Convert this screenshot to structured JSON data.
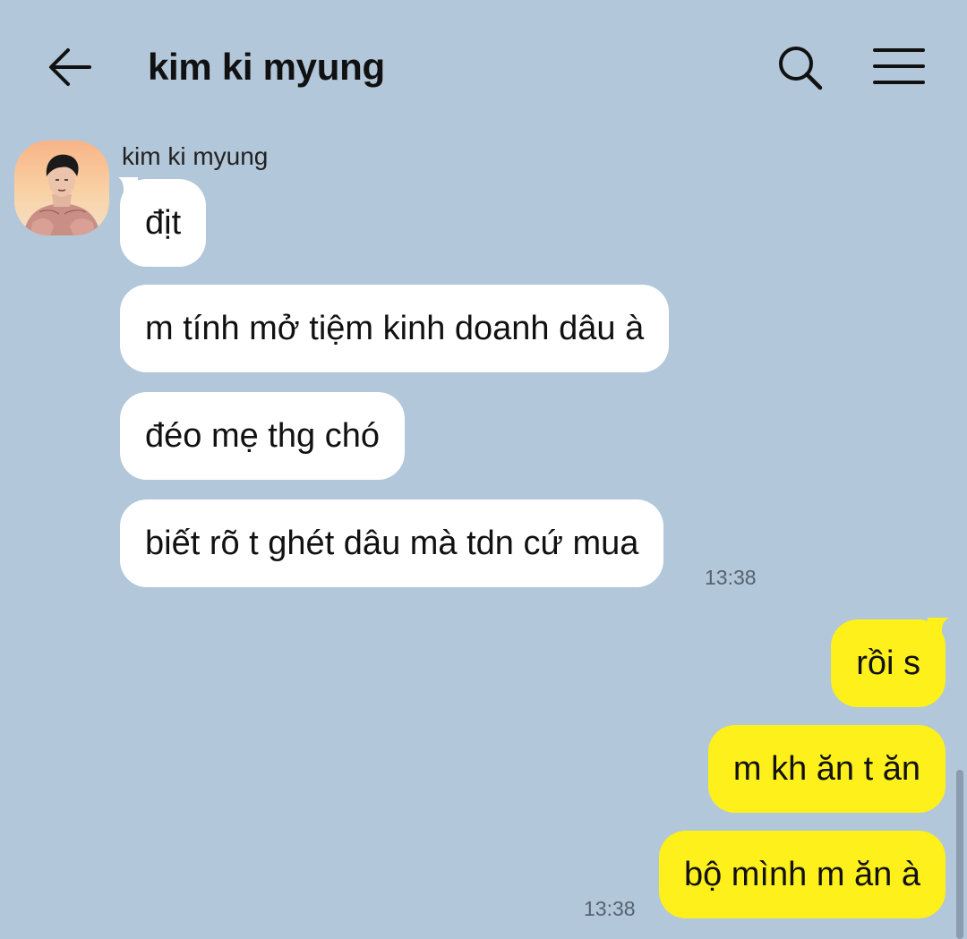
{
  "header": {
    "title": "kim ki myung",
    "back_icon": "arrow-left-icon",
    "search_icon": "search-icon",
    "menu_icon": "hamburger-menu-icon"
  },
  "chat": {
    "incoming_group": {
      "sender_name": "kim ki myung",
      "messages": [
        "địt",
        "m tính mở tiệm kinh doanh dâu à",
        "đéo mẹ thg chó",
        "biết rõ t ghét dâu mà tdn cứ mua"
      ],
      "time": "13:38"
    },
    "outgoing_group": {
      "messages": [
        "rồi s",
        "m kh ăn t ăn",
        "bộ mình m ăn à"
      ],
      "time": "13:38"
    }
  },
  "colors": {
    "background": "#b2c7d9",
    "incoming_bubble": "#ffffff",
    "outgoing_bubble": "#fef01b",
    "text": "#111111",
    "time_text": "#556270"
  }
}
